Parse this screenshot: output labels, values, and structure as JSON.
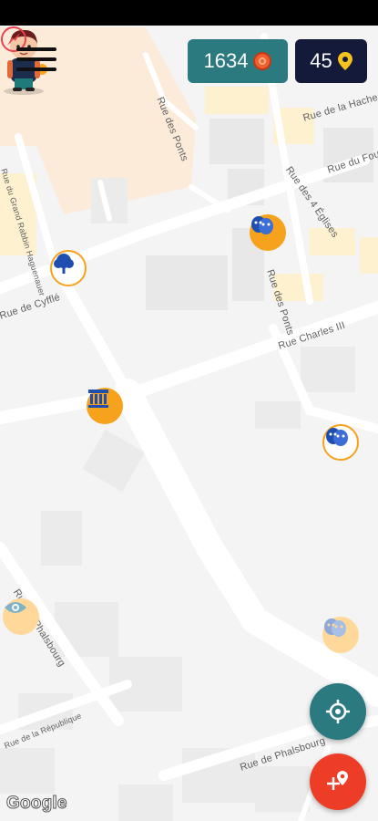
{
  "header": {
    "menu_icon": "hamburger-menu-icon",
    "score": "1634",
    "score_icon": "coin-icon",
    "places_count": "45",
    "places_icon": "location-pin-icon"
  },
  "map": {
    "streets": [
      "Rue de la Hache",
      "Rue du Four",
      "Rue des Ponts",
      "Rue des 4 Églises",
      "Rue du Grand Rabbin Haguenauer",
      "Rue de Cyfflé",
      "Rue des Ponts",
      "Rue Charles III",
      "Rue de Phalsbourg",
      "Rue de la République",
      "Rue de Phalsbourg"
    ],
    "attribution": "Google",
    "pois": [
      {
        "name": "park-tree-icon"
      },
      {
        "name": "theater-masks-icon"
      },
      {
        "name": "monument-icon"
      },
      {
        "name": "theater-masks-icon"
      },
      {
        "name": "eye-icon"
      },
      {
        "name": "theater-masks-icon"
      }
    ]
  },
  "actions": {
    "locate_icon": "crosshair-locate-icon",
    "add_icon": "add-location-pin-icon"
  },
  "colors": {
    "teal": "#2b7a80",
    "navy": "#141a3a",
    "orange": "#f6a21d",
    "red": "#ee3d26",
    "blue_icon": "#1e4fb0"
  }
}
